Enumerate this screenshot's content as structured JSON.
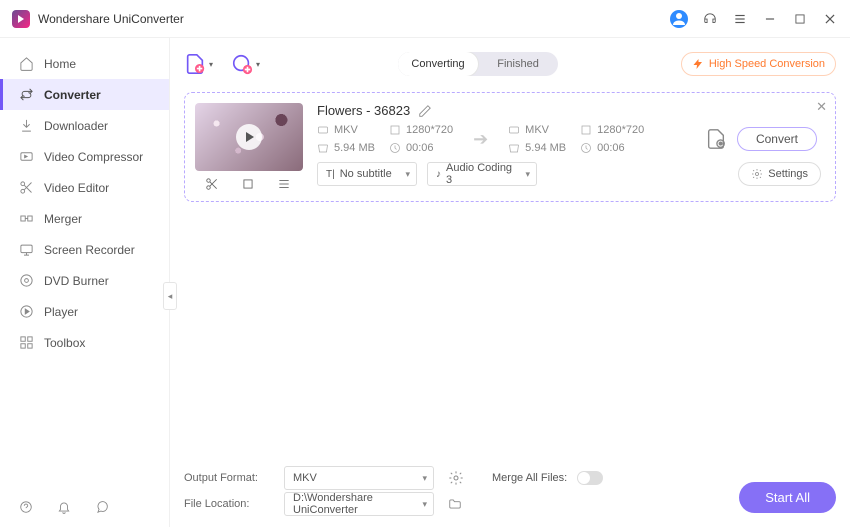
{
  "app": {
    "title": "Wondershare UniConverter"
  },
  "titlebar": {
    "avatar": "user-avatar"
  },
  "sidebar": {
    "items": [
      {
        "label": "Home"
      },
      {
        "label": "Converter"
      },
      {
        "label": "Downloader"
      },
      {
        "label": "Video Compressor"
      },
      {
        "label": "Video Editor"
      },
      {
        "label": "Merger"
      },
      {
        "label": "Screen Recorder"
      },
      {
        "label": "DVD Burner"
      },
      {
        "label": "Player"
      },
      {
        "label": "Toolbox"
      }
    ]
  },
  "tabs": {
    "converting": "Converting",
    "finished": "Finished"
  },
  "hsc": {
    "label": "High Speed Conversion"
  },
  "file": {
    "title": "Flowers - 36823",
    "src": {
      "format": "MKV",
      "resolution": "1280*720",
      "size": "5.94 MB",
      "duration": "00:06"
    },
    "dst": {
      "format": "MKV",
      "resolution": "1280*720",
      "size": "5.94 MB",
      "duration": "00:06"
    },
    "subtitle": "No subtitle",
    "audio": "Audio Coding 3",
    "settings_label": "Settings",
    "convert_label": "Convert"
  },
  "footer": {
    "output_format_label": "Output Format:",
    "output_format_value": "MKV",
    "merge_label": "Merge All Files:",
    "location_label": "File Location:",
    "location_value": "D:\\Wondershare UniConverter",
    "start_all": "Start All"
  }
}
